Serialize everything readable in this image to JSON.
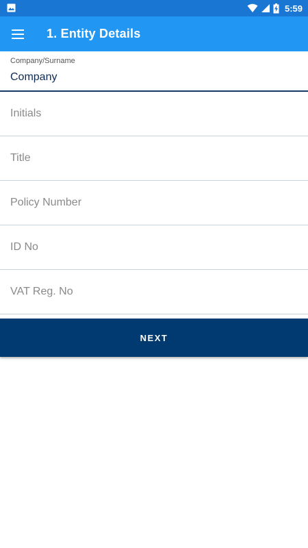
{
  "status_bar": {
    "time": "5:59",
    "icons": [
      "image-notification-icon",
      "wifi-icon",
      "signal-icon",
      "battery-charging-icon"
    ]
  },
  "app_bar": {
    "menu_icon": "hamburger-menu-icon",
    "title": "1. Entity Details",
    "color": "#2196f3"
  },
  "form": {
    "company_field": {
      "label": "Company/Surname",
      "value": "Company"
    },
    "fields": [
      {
        "placeholder": "Initials",
        "value": ""
      },
      {
        "placeholder": "Title",
        "value": ""
      },
      {
        "placeholder": "Policy Number",
        "value": ""
      },
      {
        "placeholder": "ID No",
        "value": ""
      },
      {
        "placeholder": "VAT Reg. No",
        "value": ""
      }
    ]
  },
  "next_button": {
    "label": "NEXT",
    "color": "#003a70"
  }
}
